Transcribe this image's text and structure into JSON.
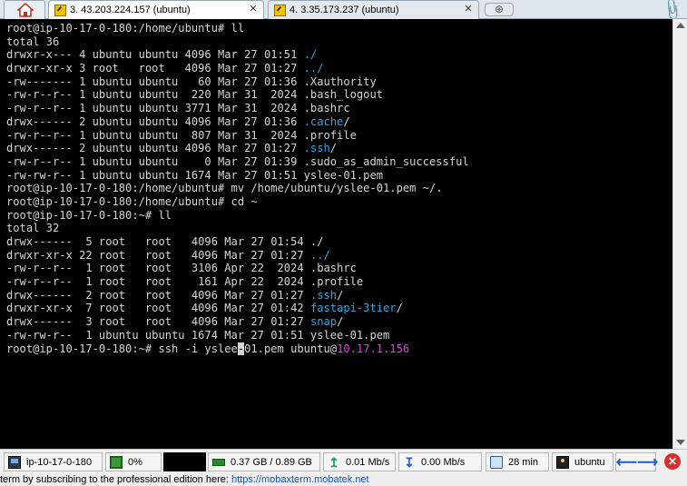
{
  "tabs": [
    {
      "label": "3. 43.203.224.157 (ubuntu)",
      "active": true
    },
    {
      "label": "4. 3.35.173.237 (ubuntu)",
      "active": false
    }
  ],
  "icons": {
    "home": "home-icon",
    "paperclip": "paperclip-icon",
    "new_tab": "new-tab-icon",
    "ssh": "key-icon"
  },
  "terminal": {
    "lines": [
      [
        {
          "t": "root@ip-10-17-0-180:/home/ubuntu# ll"
        }
      ],
      [
        {
          "t": "total 36"
        }
      ],
      [
        {
          "t": "drwxr-x--- 4 ubuntu ubuntu 4096 Mar 27 01:51 "
        },
        {
          "t": "./",
          "c": "blue"
        }
      ],
      [
        {
          "t": "drwxr-xr-x 3 root   root   4096 Mar 27 01:27 "
        },
        {
          "t": "../",
          "c": "blue"
        }
      ],
      [
        {
          "t": "-rw------- 1 ubuntu ubuntu   60 Mar 27 01:36 .Xauthority"
        }
      ],
      [
        {
          "t": "-rw-r--r-- 1 ubuntu ubuntu  220 Mar 31  2024 .bash_logout"
        }
      ],
      [
        {
          "t": "-rw-r--r-- 1 ubuntu ubuntu 3771 Mar 31  2024 .bashrc"
        }
      ],
      [
        {
          "t": "drwx------ 2 ubuntu ubuntu 4096 Mar 27 01:36 "
        },
        {
          "t": ".cache",
          "c": "blue"
        },
        {
          "t": "/"
        }
      ],
      [
        {
          "t": "-rw-r--r-- 1 ubuntu ubuntu  807 Mar 31  2024 .profile"
        }
      ],
      [
        {
          "t": "drwx------ 2 ubuntu ubuntu 4096 Mar 27 01:27 "
        },
        {
          "t": ".ssh",
          "c": "blue"
        },
        {
          "t": "/"
        }
      ],
      [
        {
          "t": "-rw-r--r-- 1 ubuntu ubuntu    0 Mar 27 01:39 .sudo_as_admin_successful"
        }
      ],
      [
        {
          "t": "-rw-rw-r-- 1 ubuntu ubuntu 1674 Mar 27 01:51 yslee-01.pem"
        }
      ],
      [
        {
          "t": "root@ip-10-17-0-180:/home/ubuntu# mv /home/ubuntu/yslee-01.pem ~/."
        }
      ],
      [
        {
          "t": "root@ip-10-17-0-180:/home/ubuntu# cd ~"
        }
      ],
      [
        {
          "t": "root@ip-10-17-0-180:~# ll"
        }
      ],
      [
        {
          "t": "total 32"
        }
      ],
      [
        {
          "t": "drwx------  5 root   root   4096 Mar 27 01:54 ./"
        }
      ],
      [
        {
          "t": "drwxr-xr-x 22 root   root   4096 Mar 27 01:27 "
        },
        {
          "t": "../",
          "c": "blue"
        }
      ],
      [
        {
          "t": "-rw-r--r--  1 root   root   3106 Apr 22  2024 .bashrc"
        }
      ],
      [
        {
          "t": "-rw-r--r--  1 root   root    161 Apr 22  2024 .profile"
        }
      ],
      [
        {
          "t": "drwx------  2 root   root   4096 Mar 27 01:27 "
        },
        {
          "t": ".ssh",
          "c": "blue"
        },
        {
          "t": "/"
        }
      ],
      [
        {
          "t": "drwxr-xr-x  7 root   root   4096 Mar 27 01:42 "
        },
        {
          "t": "fastapi-3tier",
          "c": "blue"
        },
        {
          "t": "/"
        }
      ],
      [
        {
          "t": "drwx------  3 root   root   4096 Mar 27 01:27 "
        },
        {
          "t": "snap",
          "c": "blue"
        },
        {
          "t": "/"
        }
      ],
      [
        {
          "t": "-rw-rw-r--  1 ubuntu ubuntu 1674 Mar 27 01:51 yslee-01.pem"
        }
      ],
      [
        {
          "t": "root@ip-10-17-0-180:~# ssh -i yslee"
        },
        {
          "t": "-",
          "c": "cursor"
        },
        {
          "t": "01.pem ubuntu@"
        },
        {
          "t": "10.17.1.156",
          "c": "magenta"
        }
      ]
    ]
  },
  "statusbar": {
    "host": "ip-10-17-0-180",
    "cpu": "0%",
    "memory": "0.37 GB / 0.89 GB",
    "upload": "0.01 Mb/s",
    "download": "0.00 Mb/s",
    "uptime": "28 min",
    "user": "ubuntu"
  },
  "footer": {
    "text": "term by subscribing to the professional edition here:  ",
    "link": "https://mobaxterm.mobatek.net"
  },
  "colors": {
    "terminal_bg": "#000000",
    "terminal_fg": "#d4d4d4",
    "dir_blue": "#2ea7e0",
    "ip_magenta": "#e040e0",
    "close_red": "#d83030"
  }
}
